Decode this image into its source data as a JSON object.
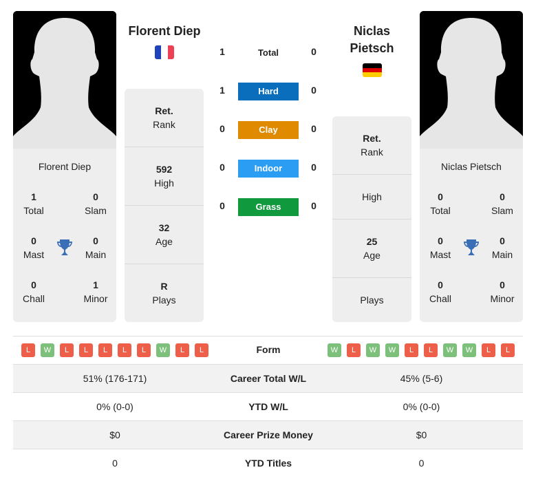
{
  "player1": {
    "name": "Florent Diep",
    "header_name": "Florent Diep",
    "country": "France",
    "flag_colors": [
      "#1f43b8",
      "#ffffff",
      "#ef4155"
    ],
    "titles": {
      "total": {
        "value": "1",
        "label": "Total"
      },
      "slam": {
        "value": "0",
        "label": "Slam"
      },
      "mast": {
        "value": "0",
        "label": "Mast"
      },
      "main": {
        "value": "0",
        "label": "Main"
      },
      "chall": {
        "value": "0",
        "label": "Chall"
      },
      "minor": {
        "value": "1",
        "label": "Minor"
      }
    },
    "rank": {
      "value": "Ret.",
      "label": "Rank"
    },
    "high": {
      "value": "592",
      "label": "High"
    },
    "age": {
      "value": "32",
      "label": "Age"
    },
    "plays": {
      "value": "R",
      "label": "Plays"
    },
    "form": [
      "L",
      "W",
      "L",
      "L",
      "L",
      "L",
      "L",
      "W",
      "L",
      "L"
    ]
  },
  "player2": {
    "name": "Niclas Pietsch",
    "header_name_line1": "Niclas",
    "header_name_line2": "Pietsch",
    "country": "Germany",
    "flag_colors": [
      "#000000",
      "#dd0000",
      "#ffce00"
    ],
    "titles": {
      "total": {
        "value": "0",
        "label": "Total"
      },
      "slam": {
        "value": "0",
        "label": "Slam"
      },
      "mast": {
        "value": "0",
        "label": "Mast"
      },
      "main": {
        "value": "0",
        "label": "Main"
      },
      "chall": {
        "value": "0",
        "label": "Chall"
      },
      "minor": {
        "value": "0",
        "label": "Minor"
      }
    },
    "rank": {
      "value": "Ret.",
      "label": "Rank"
    },
    "high": {
      "value": "",
      "label": "High"
    },
    "age": {
      "value": "25",
      "label": "Age"
    },
    "plays": {
      "value": "",
      "label": "Plays"
    },
    "form": [
      "W",
      "L",
      "W",
      "W",
      "L",
      "L",
      "W",
      "W",
      "L",
      "L"
    ]
  },
  "h2h": [
    {
      "label": "Total",
      "p1": "1",
      "p2": "0",
      "color": null
    },
    {
      "label": "Hard",
      "p1": "1",
      "p2": "0",
      "color": "#0a6ebd"
    },
    {
      "label": "Clay",
      "p1": "0",
      "p2": "0",
      "color": "#e08a00"
    },
    {
      "label": "Indoor",
      "p1": "0",
      "p2": "0",
      "color": "#2b9ef4"
    },
    {
      "label": "Grass",
      "p1": "0",
      "p2": "0",
      "color": "#119a3d"
    }
  ],
  "form_label": "Form",
  "form_colors": {
    "W": "#7dc07b",
    "L": "#ee5f4a"
  },
  "stats": [
    {
      "label": "Career Total W/L",
      "p1": "51% (176-171)",
      "p2": "45% (5-6)"
    },
    {
      "label": "YTD W/L",
      "p1": "0% (0-0)",
      "p2": "0% (0-0)"
    },
    {
      "label": "Career Prize Money",
      "p1": "$0",
      "p2": "$0"
    },
    {
      "label": "YTD Titles",
      "p1": "0",
      "p2": "0"
    }
  ],
  "trophy_color": "#3a6fb8"
}
